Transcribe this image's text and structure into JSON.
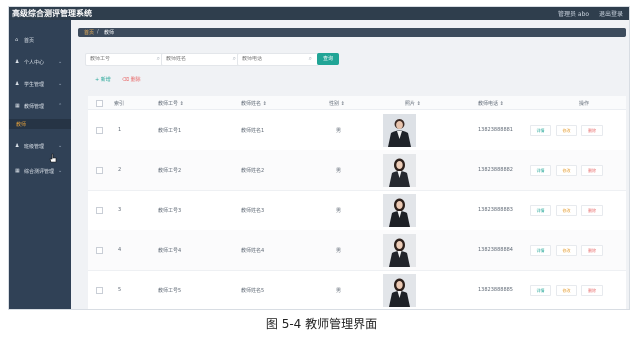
{
  "app": {
    "title": "高级综合测评管理系统",
    "user_label": "管理员 abo",
    "logout_label": "退出登录"
  },
  "sidebar": {
    "items": [
      {
        "icon": "home-icon",
        "glyph": "⌂",
        "label": "首页"
      },
      {
        "icon": "user-icon",
        "glyph": "♟",
        "label": "个人中心"
      },
      {
        "icon": "user-icon",
        "glyph": "♟",
        "label": "学生管理"
      },
      {
        "icon": "grid-icon",
        "glyph": "▦",
        "label": "教师管理"
      },
      {
        "icon": "",
        "glyph": "",
        "label": "教师"
      },
      {
        "icon": "user-icon",
        "glyph": "♟",
        "label": "班级管理"
      },
      {
        "icon": "grid-icon",
        "glyph": "▦",
        "label": "综合测评管理"
      }
    ]
  },
  "breadcrumb": {
    "home": "首页",
    "separator": "/",
    "current": "教师"
  },
  "search": {
    "fields": [
      {
        "placeholder": "教师工号",
        "value": ""
      },
      {
        "placeholder": "教师姓名",
        "value": ""
      },
      {
        "placeholder": "教师电话",
        "value": ""
      }
    ],
    "button_label": "查询"
  },
  "toolbar": {
    "add_label": "+ 新增",
    "delete_label": "删除"
  },
  "table": {
    "headers": {
      "index": "索引",
      "teacher_no": "教师工号 ⇕",
      "teacher_name": "教师姓名 ⇕",
      "gender": "性别 ⇕",
      "photo": "照片 ⇕",
      "phone": "教师电话 ⇕",
      "actions": "操作"
    },
    "rows": [
      {
        "index": "1",
        "teacher_no": "教师工号1",
        "teacher_name": "教师姓名1",
        "gender": "男",
        "phone": "13823888881"
      },
      {
        "index": "2",
        "teacher_no": "教师工号2",
        "teacher_name": "教师姓名2",
        "gender": "男",
        "phone": "13823888882"
      },
      {
        "index": "3",
        "teacher_no": "教师工号3",
        "teacher_name": "教师姓名3",
        "gender": "男",
        "phone": "13823888883"
      },
      {
        "index": "4",
        "teacher_no": "教师工号4",
        "teacher_name": "教师姓名4",
        "gender": "男",
        "phone": "13823888884"
      },
      {
        "index": "5",
        "teacher_no": "教师工号5",
        "teacher_name": "教师姓名5",
        "gender": "男",
        "phone": "13823888885"
      }
    ],
    "row_actions": {
      "detail": "详情",
      "edit": "修改",
      "delete": "删除"
    }
  },
  "caption": "图 5-4 教师管理界面",
  "colors": {
    "accent": "#21a596",
    "topbar": "#2f3e4d",
    "sidebar": "#304156",
    "active_text": "#e6a23c",
    "danger": "#e86a6a"
  }
}
